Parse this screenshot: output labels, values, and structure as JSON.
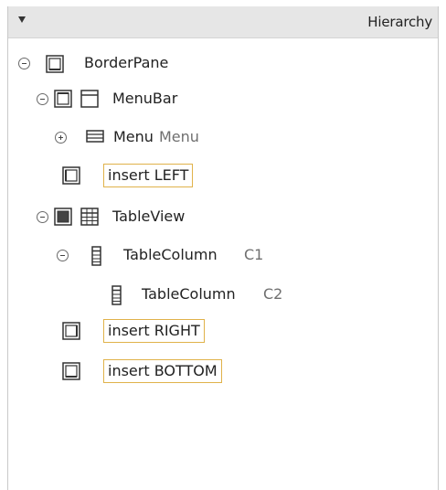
{
  "panel": {
    "title": "Hierarchy",
    "collapse_icon": "triangle-down-icon"
  },
  "tree": {
    "border_pane": {
      "label": "BorderPane",
      "expanded": true
    },
    "menu_bar": {
      "label": "MenuBar",
      "expanded": true
    },
    "menu": {
      "label": "Menu",
      "text": "Menu",
      "expanded": false
    },
    "insert_left": {
      "label": "insert LEFT"
    },
    "table_view": {
      "label": "TableView",
      "expanded": true
    },
    "table_column_1": {
      "label": "TableColumn",
      "text": "C1",
      "expanded": true
    },
    "table_column_2": {
      "label": "TableColumn",
      "text": "C2"
    },
    "insert_right": {
      "label": "insert RIGHT"
    },
    "insert_bottom": {
      "label": "insert BOTTOM"
    }
  },
  "colors": {
    "header_bg": "#e6e6e6",
    "insert_border": "#e0b24a",
    "text": "#222222",
    "secondary_text": "#6f6f6f"
  }
}
